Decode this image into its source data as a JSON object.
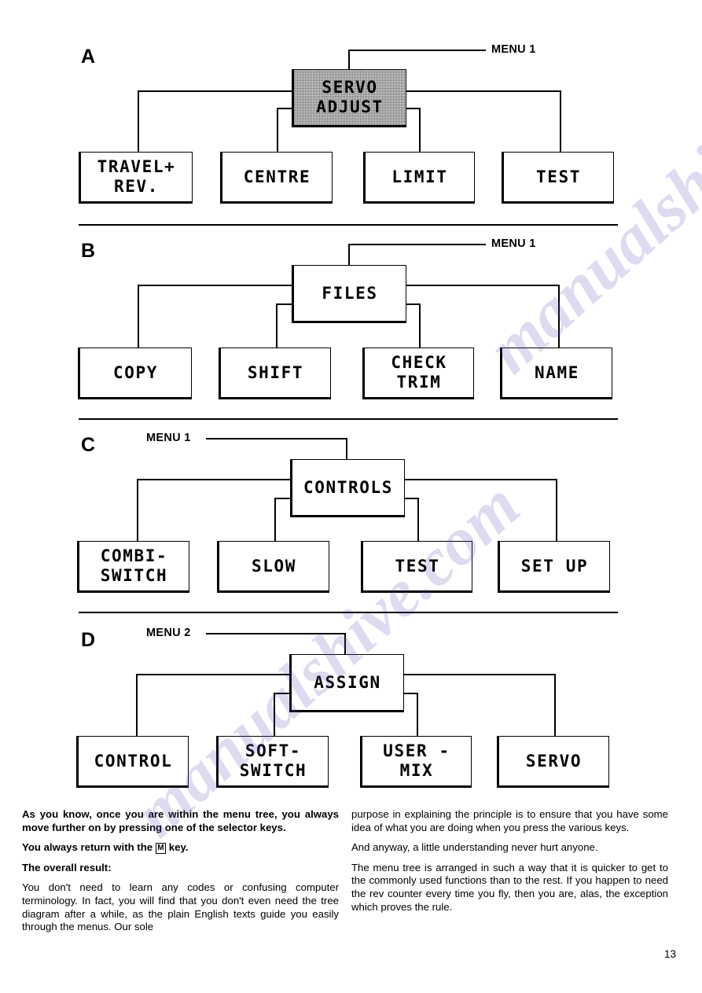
{
  "page": {
    "number": "13"
  },
  "sections": [
    {
      "letter": "A",
      "menu_label": "MENU 1",
      "parent": {
        "lines": [
          "SERVO",
          "ADJUST"
        ],
        "shaded": true
      },
      "children": [
        {
          "lines": [
            "TRAVEL+",
            "REV."
          ]
        },
        {
          "lines": [
            "CENTRE"
          ]
        },
        {
          "lines": [
            "LIMIT"
          ]
        },
        {
          "lines": [
            "TEST"
          ]
        }
      ]
    },
    {
      "letter": "B",
      "menu_label": "MENU 1",
      "parent": {
        "lines": [
          "FILES"
        ],
        "shaded": false
      },
      "children": [
        {
          "lines": [
            "COPY"
          ]
        },
        {
          "lines": [
            "SHIFT"
          ]
        },
        {
          "lines": [
            "CHECK",
            "TRIM"
          ]
        },
        {
          "lines": [
            "NAME"
          ]
        }
      ]
    },
    {
      "letter": "C",
      "menu_label": "MENU 1",
      "parent": {
        "lines": [
          "CONTROLS"
        ],
        "shaded": false
      },
      "children": [
        {
          "lines": [
            "COMBI-",
            "SWITCH"
          ]
        },
        {
          "lines": [
            "SLOW"
          ]
        },
        {
          "lines": [
            "TEST"
          ]
        },
        {
          "lines": [
            "SET UP"
          ]
        }
      ]
    },
    {
      "letter": "D",
      "menu_label": "MENU 2",
      "parent": {
        "lines": [
          "ASSIGN"
        ],
        "shaded": false
      },
      "children": [
        {
          "lines": [
            "CONTROL"
          ]
        },
        {
          "lines": [
            "SOFT-",
            "SWITCH"
          ]
        },
        {
          "lines": [
            "USER -",
            "MIX"
          ]
        },
        {
          "lines": [
            "SERVO"
          ]
        }
      ]
    }
  ],
  "body": {
    "left": [
      "As you know, once you are within the menu tree, you always move further on by pressing one of the selector keys.",
      "You always return with the ",
      " key.",
      "The overall result:",
      "You don't need to learn any codes or confusing computer terminology. In fact, you will find that you don't even need the tree diagram after a while, as the plain English texts guide you easily through the menus. Our sole"
    ],
    "right": [
      "purpose in explaining the principle is to ensure that you have some idea of what you are doing when you press the various keys.",
      "And anyway, a little understanding never hurt anyone.",
      "The menu tree is arranged in such a way that it is quicker to get to the commonly used functions than to the rest. If you happen to need the rev counter every time you fly, then you are, alas, the exception which proves the rule."
    ],
    "m_key_glyph": "M"
  },
  "watermark": {
    "text": "manualshive.com"
  }
}
